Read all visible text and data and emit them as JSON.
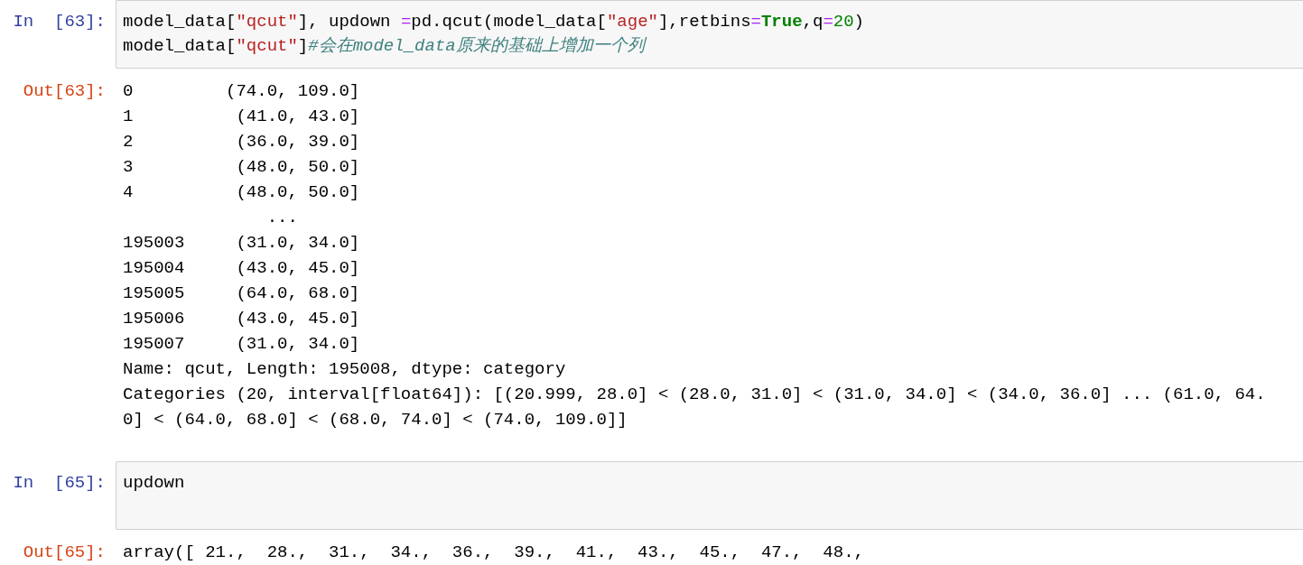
{
  "cells": [
    {
      "kind": "input",
      "prompt": "In  [63]:",
      "lines": [
        [
          {
            "kind": "text",
            "text": "model_data["
          },
          {
            "kind": "string",
            "text": "\"qcut\""
          },
          {
            "kind": "text",
            "text": "], updown "
          },
          {
            "kind": "op",
            "text": "="
          },
          {
            "kind": "text",
            "text": "pd.qcut(model_data["
          },
          {
            "kind": "string",
            "text": "\"age\""
          },
          {
            "kind": "text",
            "text": "],retbins"
          },
          {
            "kind": "op",
            "text": "="
          },
          {
            "kind": "kw",
            "text": "True"
          },
          {
            "kind": "text",
            "text": ",q"
          },
          {
            "kind": "op",
            "text": "="
          },
          {
            "kind": "num",
            "text": "20"
          },
          {
            "kind": "text",
            "text": ")"
          }
        ],
        [
          {
            "kind": "text",
            "text": "model_data["
          },
          {
            "kind": "string",
            "text": "\"qcut\""
          },
          {
            "kind": "text",
            "text": "]"
          },
          {
            "kind": "comment",
            "text": "#会在model_data原来的基础上增加一个列"
          }
        ]
      ]
    },
    {
      "kind": "output",
      "prompt": "Out[63]:",
      "lines": [
        "0         (74.0, 109.0]",
        "1          (41.0, 43.0]",
        "2          (36.0, 39.0]",
        "3          (48.0, 50.0]",
        "4          (48.0, 50.0]",
        "              ...      ",
        "195003     (31.0, 34.0]",
        "195004     (43.0, 45.0]",
        "195005     (64.0, 68.0]",
        "195006     (43.0, 45.0]",
        "195007     (31.0, 34.0]",
        "Name: qcut, Length: 195008, dtype: category",
        "Categories (20, interval[float64]): [(20.999, 28.0] < (28.0, 31.0] < (31.0, 34.0] < (34.0, 36.0] ... (61.0, 64.",
        "0] < (64.0, 68.0] < (68.0, 74.0] < (74.0, 109.0]]"
      ]
    },
    {
      "kind": "input",
      "prompt": "In  [65]:",
      "lines": [
        [
          {
            "kind": "text",
            "text": "updown"
          }
        ]
      ]
    },
    {
      "kind": "output",
      "prompt": "Out[65]:",
      "lines": [
        "array([ 21.,  28.,  31.,  34.,  36.,  39.,  41.,  43.,  45.,  47.,  48.,"
      ]
    }
  ]
}
